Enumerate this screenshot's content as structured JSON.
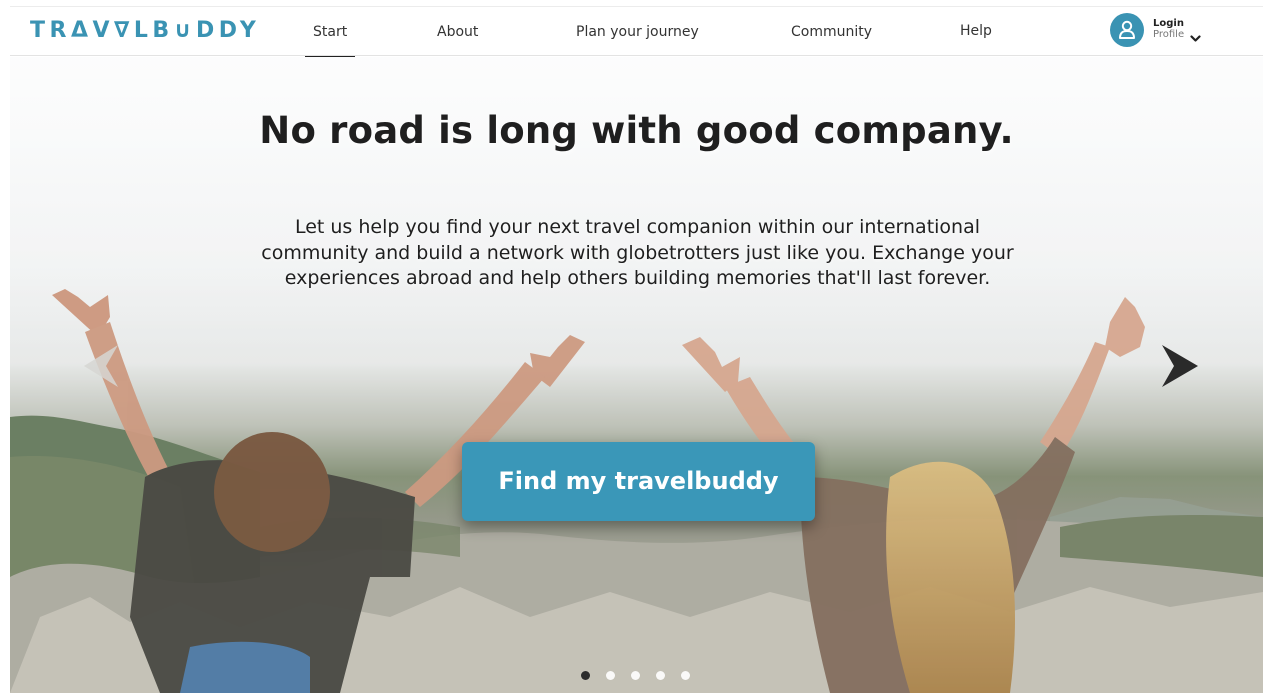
{
  "brand": {
    "logo_part1": "TRΔV∇L",
    "logo_part2": "B∪DDY",
    "color": "#3a93b3"
  },
  "nav": {
    "items": [
      {
        "label": "Start",
        "active": true
      },
      {
        "label": "About",
        "active": false
      },
      {
        "label": "Plan your journey",
        "active": false
      },
      {
        "label": "Community",
        "active": false
      },
      {
        "label": "Help",
        "active": false
      }
    ]
  },
  "user": {
    "login_label": "Login",
    "profile_label": "Profile",
    "avatar_icon": "user-icon",
    "dropdown_icon": "chevron-down-icon"
  },
  "hero": {
    "headline": "No road is long with good company.",
    "subtext": "Let us help you find your next travel companion within our international community and build a network with globetrotters just like you. Exchange your experiences abroad and help others building memories that'll last forever.",
    "cta_label": "Find my travelbuddy",
    "cta_color": "#3a97b8",
    "prev_icon": "chevron-left-icon",
    "next_icon": "chevron-right-icon",
    "slides_total": 5,
    "active_slide": 1
  }
}
